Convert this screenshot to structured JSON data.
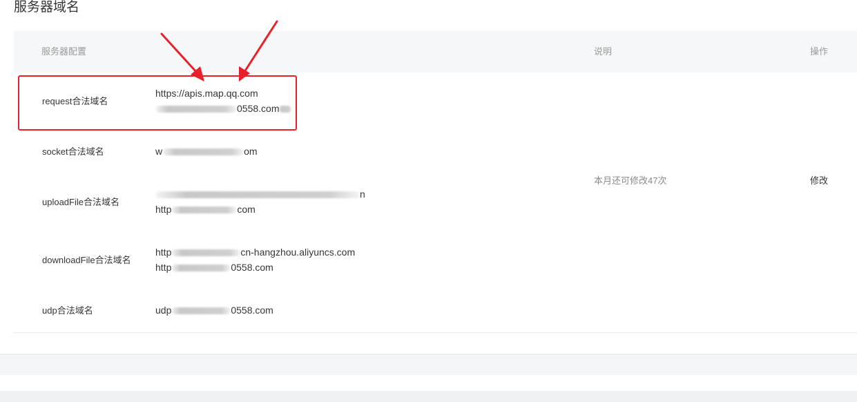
{
  "page": {
    "title": "服务器域名"
  },
  "table": {
    "headers": {
      "config": "服务器配置",
      "description": "说明",
      "operations": "操作"
    },
    "rows": [
      {
        "label": "request合法域名",
        "domains": [
          {
            "before": "https://apis.map.qq.com",
            "after": ""
          },
          {
            "before": "",
            "after": "0558.com"
          }
        ]
      },
      {
        "label": "socket合法域名",
        "domains": [
          {
            "before": "w",
            "after": "om"
          }
        ]
      },
      {
        "label": "uploadFile合法域名",
        "domains": [
          {
            "before": "",
            "after": "n"
          },
          {
            "before": "http",
            "after": "com"
          }
        ]
      },
      {
        "label": "downloadFile合法域名",
        "domains": [
          {
            "before": "http",
            "after": "cn-hangzhou.aliyuncs.com"
          },
          {
            "before": "http",
            "after": "0558.com"
          }
        ]
      },
      {
        "label": "udp合法域名",
        "domains": [
          {
            "before": "udp",
            "after": "0558.com"
          }
        ]
      }
    ],
    "description": "本月还可修改47次",
    "edit_label": "修改"
  },
  "annotation_color": "#e8202a"
}
